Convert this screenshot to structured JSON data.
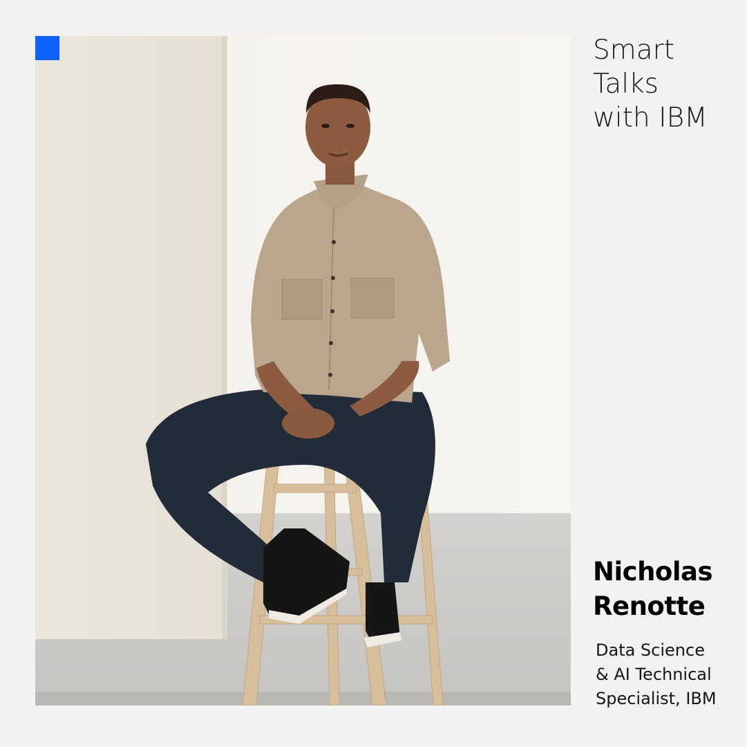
{
  "brand": {
    "accent_color": "#0f62fe"
  },
  "show": {
    "title_lines": [
      "Smart",
      "Talks",
      "with IBM"
    ]
  },
  "guest": {
    "name_lines": [
      "Nicholas",
      "Renotte"
    ],
    "role_lines": [
      "Data Science",
      "& AI Technical",
      "Specialist, IBM"
    ]
  },
  "photo": {
    "subject": "portrait-of-guest-seated-on-wooden-stool"
  }
}
